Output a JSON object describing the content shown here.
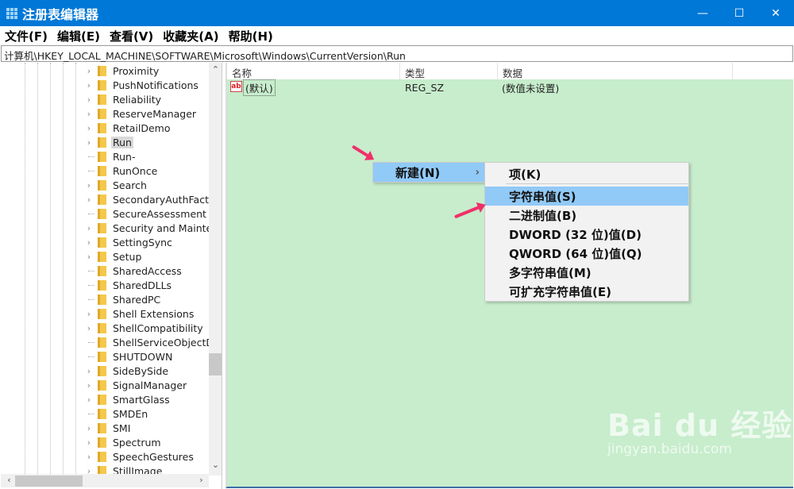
{
  "window": {
    "title": "注册表编辑器",
    "accent": "#0078d7",
    "minimize": "—",
    "maximize": "☐",
    "close": "✕"
  },
  "menu": [
    "文件(F)",
    "编辑(E)",
    "查看(V)",
    "收藏夹(A)",
    "帮助(H)"
  ],
  "address": "计算机\\HKEY_LOCAL_MACHINE\\SOFTWARE\\Microsoft\\Windows\\CurrentVersion\\Run",
  "tree": {
    "selected": "Run",
    "items": [
      {
        "label": "Proximity",
        "expandable": true
      },
      {
        "label": "PushNotifications",
        "expandable": true
      },
      {
        "label": "Reliability",
        "expandable": true
      },
      {
        "label": "ReserveManager",
        "expandable": true
      },
      {
        "label": "RetailDemo",
        "expandable": true
      },
      {
        "label": "Run",
        "expandable": true
      },
      {
        "label": "Run-",
        "expandable": false
      },
      {
        "label": "RunOnce",
        "expandable": false
      },
      {
        "label": "Search",
        "expandable": true
      },
      {
        "label": "SecondaryAuthFacto",
        "expandable": true
      },
      {
        "label": "SecureAssessment",
        "expandable": false
      },
      {
        "label": "Security and Mainter",
        "expandable": true
      },
      {
        "label": "SettingSync",
        "expandable": true
      },
      {
        "label": "Setup",
        "expandable": true
      },
      {
        "label": "SharedAccess",
        "expandable": false
      },
      {
        "label": "SharedDLLs",
        "expandable": false
      },
      {
        "label": "SharedPC",
        "expandable": false
      },
      {
        "label": "Shell Extensions",
        "expandable": true
      },
      {
        "label": "ShellCompatibility",
        "expandable": true
      },
      {
        "label": "ShellServiceObjectD",
        "expandable": false
      },
      {
        "label": "SHUTDOWN",
        "expandable": false
      },
      {
        "label": "SideBySide",
        "expandable": true
      },
      {
        "label": "SignalManager",
        "expandable": true
      },
      {
        "label": "SmartGlass",
        "expandable": true
      },
      {
        "label": "SMDEn",
        "expandable": false
      },
      {
        "label": "SMI",
        "expandable": true
      },
      {
        "label": "Spectrum",
        "expandable": true
      },
      {
        "label": "SpeechGestures",
        "expandable": true
      },
      {
        "label": "StillImage",
        "expandable": true
      }
    ]
  },
  "columns": [
    "名称",
    "类型",
    "数据"
  ],
  "values": [
    {
      "name": "(默认)",
      "type": "REG_SZ",
      "data": "(数值未设置)"
    }
  ],
  "context_menu": {
    "new": "新建(N)",
    "submenu_arrow": "›",
    "highlighted": "字符串值(S)",
    "submenu": [
      "项(K)",
      "字符串值(S)",
      "二进制值(B)",
      "DWORD (32 位)值(D)",
      "QWORD (64 位)值(Q)",
      "多字符串值(M)",
      "可扩充字符串值(E)"
    ]
  },
  "background_color": "#c7edcc",
  "watermark": {
    "logo": "Bai du 经验",
    "url": "jingyan.baidu.com"
  }
}
